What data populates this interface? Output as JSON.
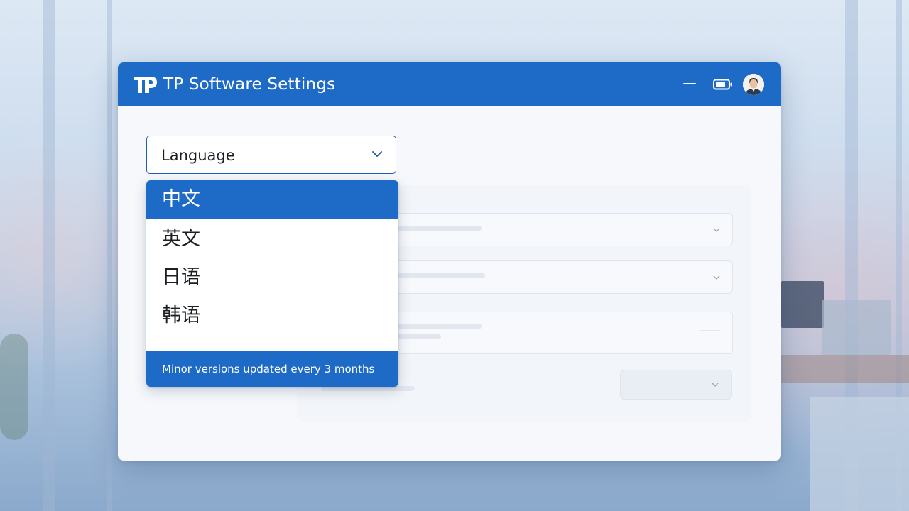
{
  "window": {
    "title": "TP Software Settings",
    "logo_text": "TP",
    "accent_color": "#1d6bc6"
  },
  "titlebar": {
    "icons": [
      "minimize-icon",
      "battery-icon",
      "user-avatar"
    ]
  },
  "language_select": {
    "label": "Language",
    "icon": "chevron-down-icon"
  },
  "dropdown": {
    "options": [
      {
        "label": "中文",
        "selected": true
      },
      {
        "label": "英文",
        "selected": false
      },
      {
        "label": "日语",
        "selected": false
      },
      {
        "label": "韩语",
        "selected": false
      }
    ],
    "footer": "Minor versions updated every 3 months"
  }
}
